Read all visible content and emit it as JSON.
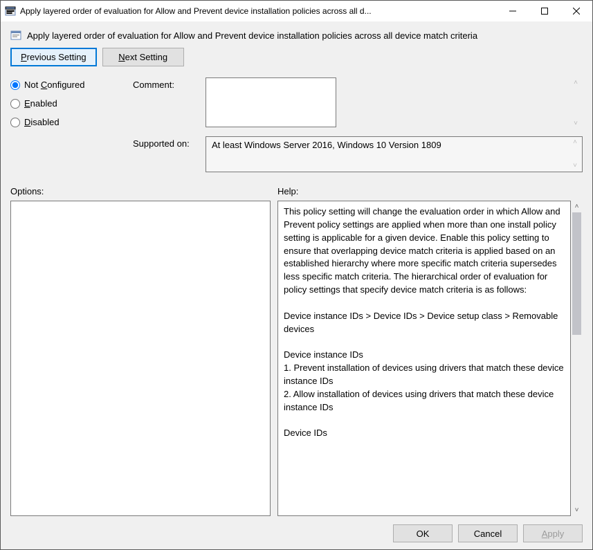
{
  "window": {
    "title": "Apply layered order of evaluation for Allow and Prevent device installation policies across all d..."
  },
  "header": {
    "policy_title": "Apply layered order of evaluation for Allow and Prevent device installation policies across all device match criteria"
  },
  "nav": {
    "prev_prefix": "P",
    "prev_rest": "revious Setting",
    "next_prefix": "N",
    "next_rest": "ext Setting"
  },
  "radios": {
    "not_configured_prefix": "Not ",
    "not_configured_ul": "C",
    "not_configured_rest": "onfigured",
    "enabled_ul": "E",
    "enabled_rest": "nabled",
    "disabled_ul": "D",
    "disabled_rest": "isabled",
    "selected": "not_configured"
  },
  "fields": {
    "comment_label": "Comment:",
    "comment_value": "",
    "supported_label": "Supported on:",
    "supported_value": "At least Windows Server 2016, Windows 10 Version 1809"
  },
  "panels": {
    "options_label": "Options:",
    "help_label": "Help:",
    "help_text": "This policy setting will change the evaluation order in which Allow and Prevent policy settings are applied when more than one install policy setting is applicable for a given device. Enable this policy setting to ensure that overlapping device match criteria is applied based on an established hierarchy where more specific match criteria supersedes less specific match criteria. The hierarchical order of evaluation for policy settings that specify device match criteria is as follows:\n\nDevice instance IDs > Device IDs > Device setup class > Removable devices\n\nDevice instance IDs\n1. Prevent installation of devices using drivers that match these device instance IDs\n2. Allow installation of devices using drivers that match these device instance IDs\n\nDevice IDs"
  },
  "footer": {
    "ok": "OK",
    "cancel": "Cancel",
    "apply_ul": "A",
    "apply_rest": "pply"
  }
}
